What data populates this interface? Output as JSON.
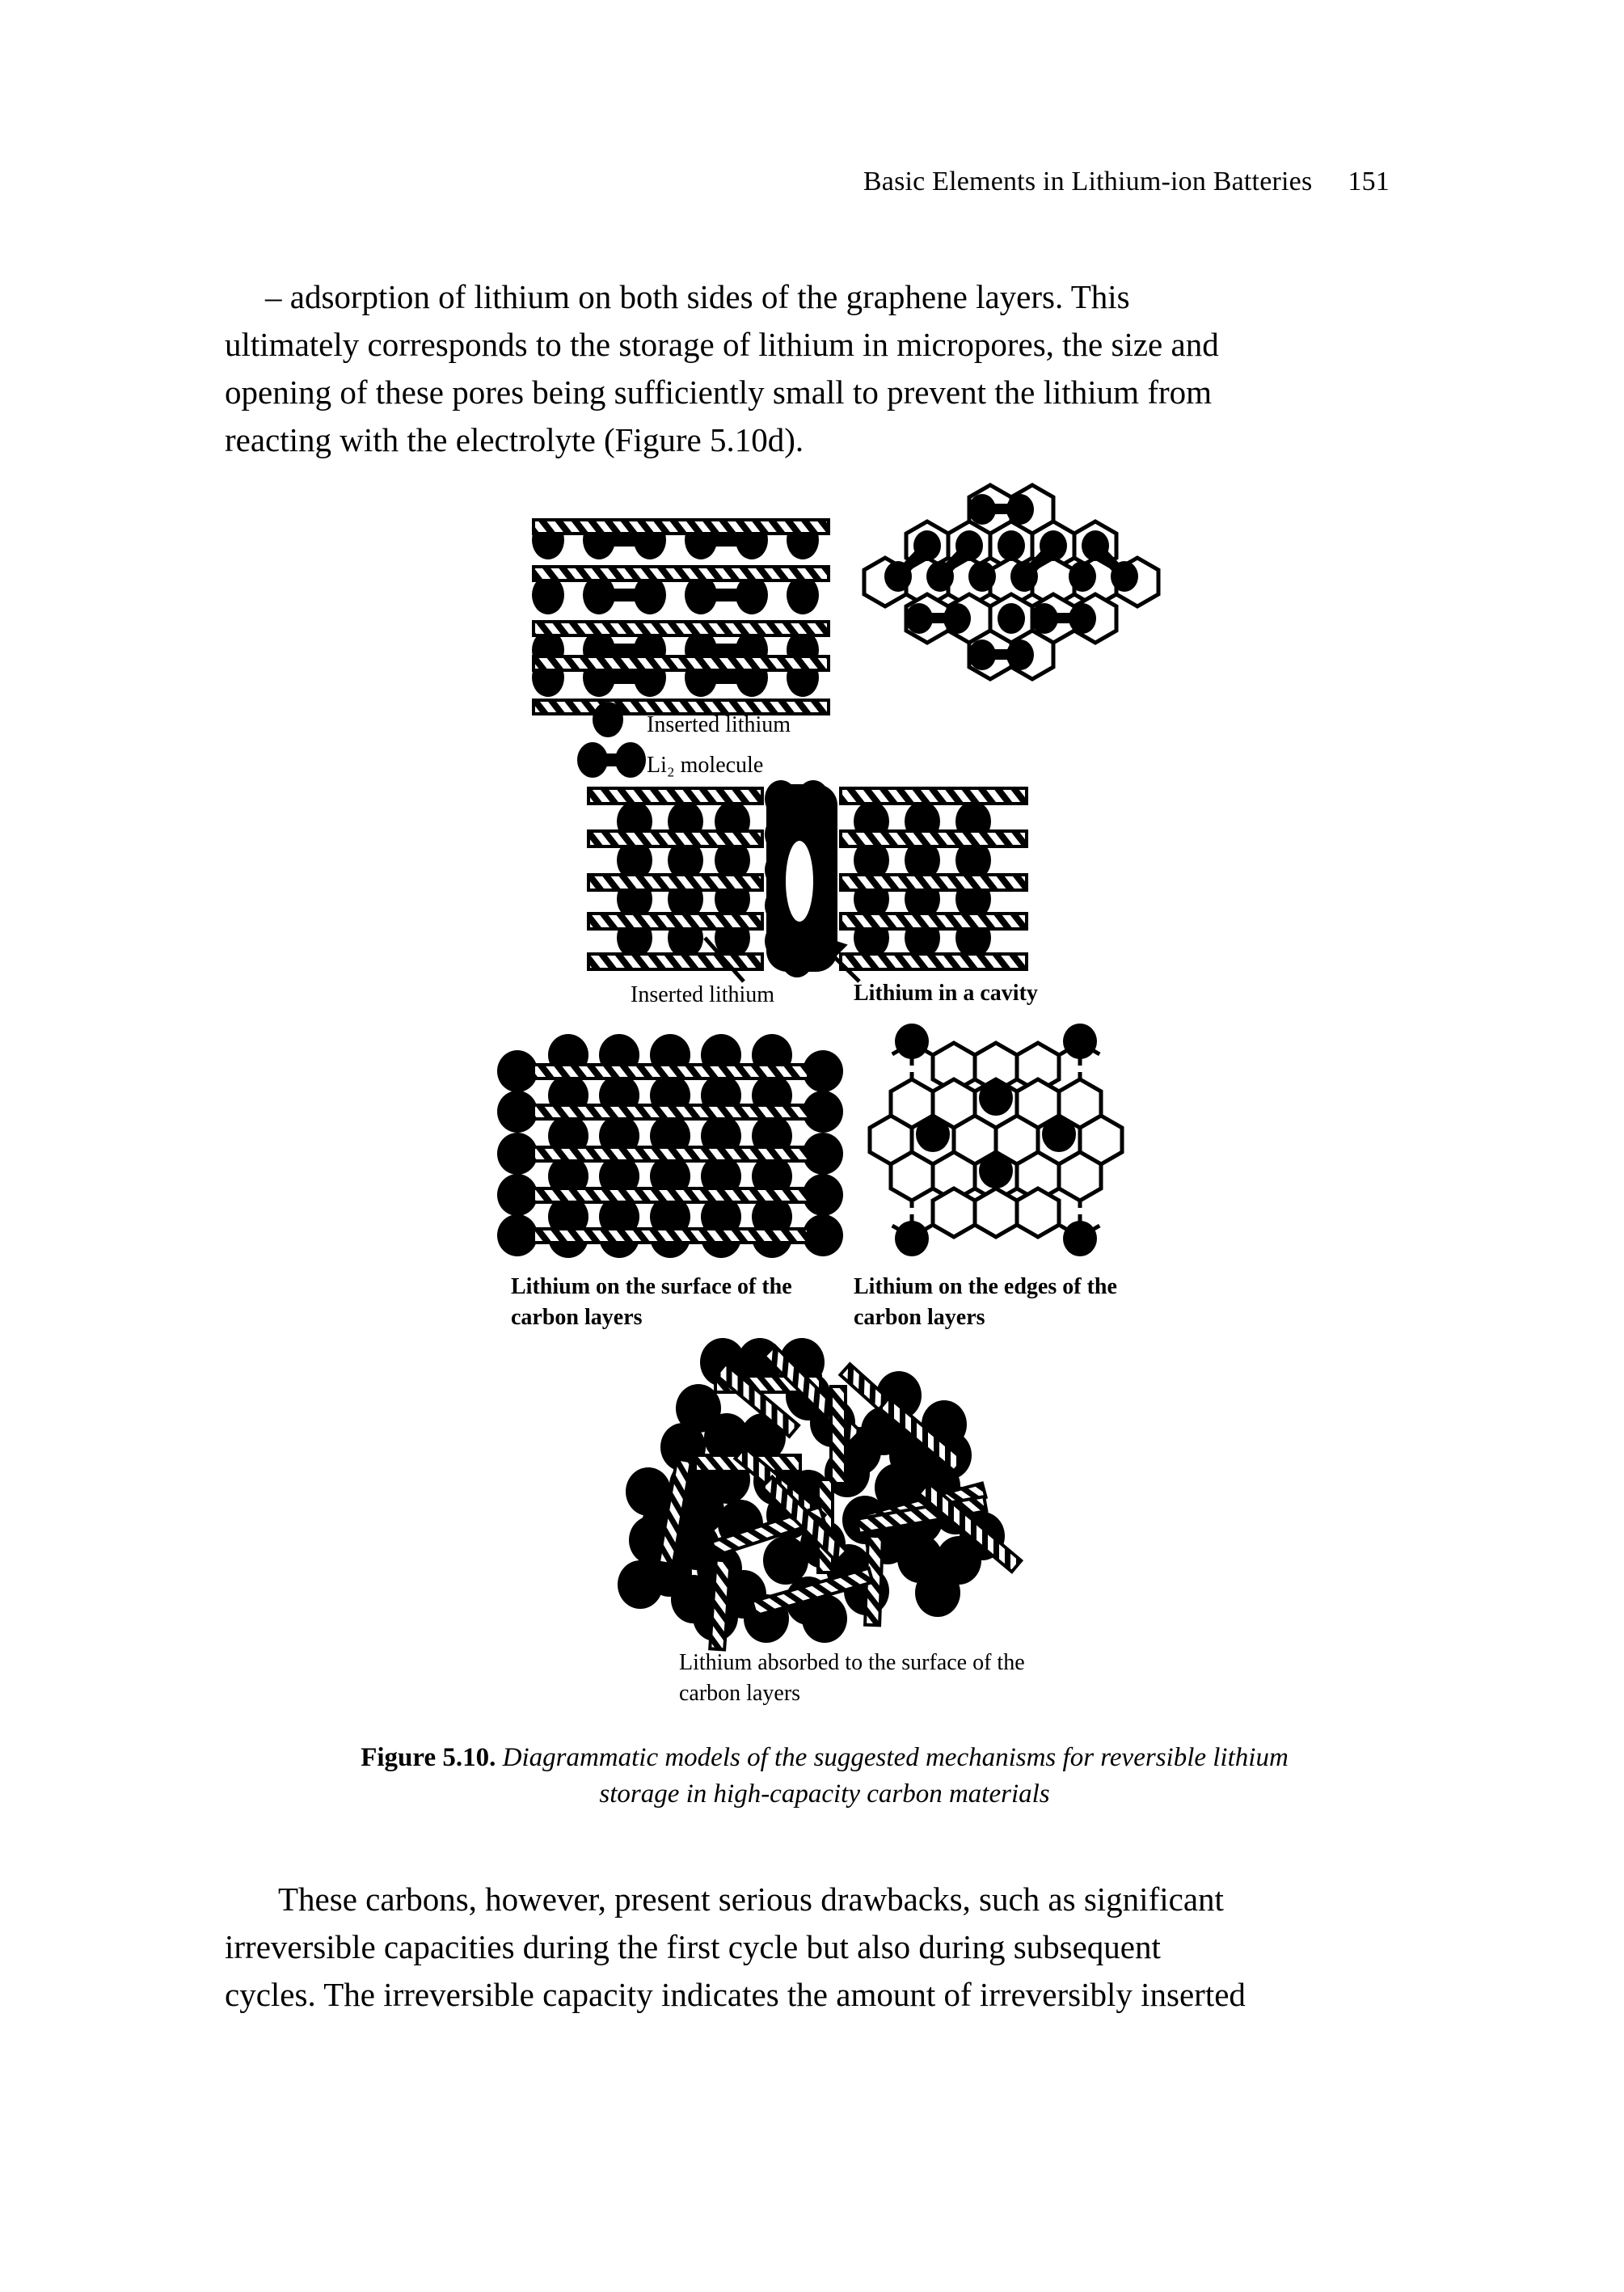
{
  "running_head": {
    "title": "Basic Elements in Lithium-ion Batteries",
    "page_number": "151"
  },
  "paragraphs": {
    "intro_line1": "– adsorption of lithium on both sides of the graphene layers. This",
    "intro_line2": "ultimately corresponds to the storage of lithium in micropores, the size and",
    "intro_line3": "opening of these pores being sufficiently small to prevent the lithium from",
    "intro_line4": "reacting with the electrolyte (Figure 5.10d).",
    "outro_line1": "These carbons, however, present serious drawbacks, such as significant",
    "outro_line2": "irreversible capacities during the first cycle but also during subsequent",
    "outro_line3": "cycles. The irreversible capacity indicates the amount of irreversibly inserted"
  },
  "figure": {
    "legend": {
      "inserted_lithium": "Inserted lithium",
      "li2_molecule": "Li₂ molecule"
    },
    "labels": {
      "inserted_lithium": "Inserted lithium",
      "lithium_in_cavity": "Lithium in a cavity",
      "lithium_on_surface": "Lithium on the surface of the carbon layers",
      "lithium_on_edges": "Lithium on the edges of the carbon layers",
      "lithium_absorbed": "Lithium absorbed to the surface of the carbon layers"
    },
    "caption": {
      "number": "Figure 5.10.",
      "text_line1": "Diagrammatic models of the suggested mechanisms for reversible lithium",
      "text_line2": "storage in high-capacity carbon materials"
    }
  },
  "colors": {
    "ink": "#000000",
    "paper": "#ffffff"
  }
}
